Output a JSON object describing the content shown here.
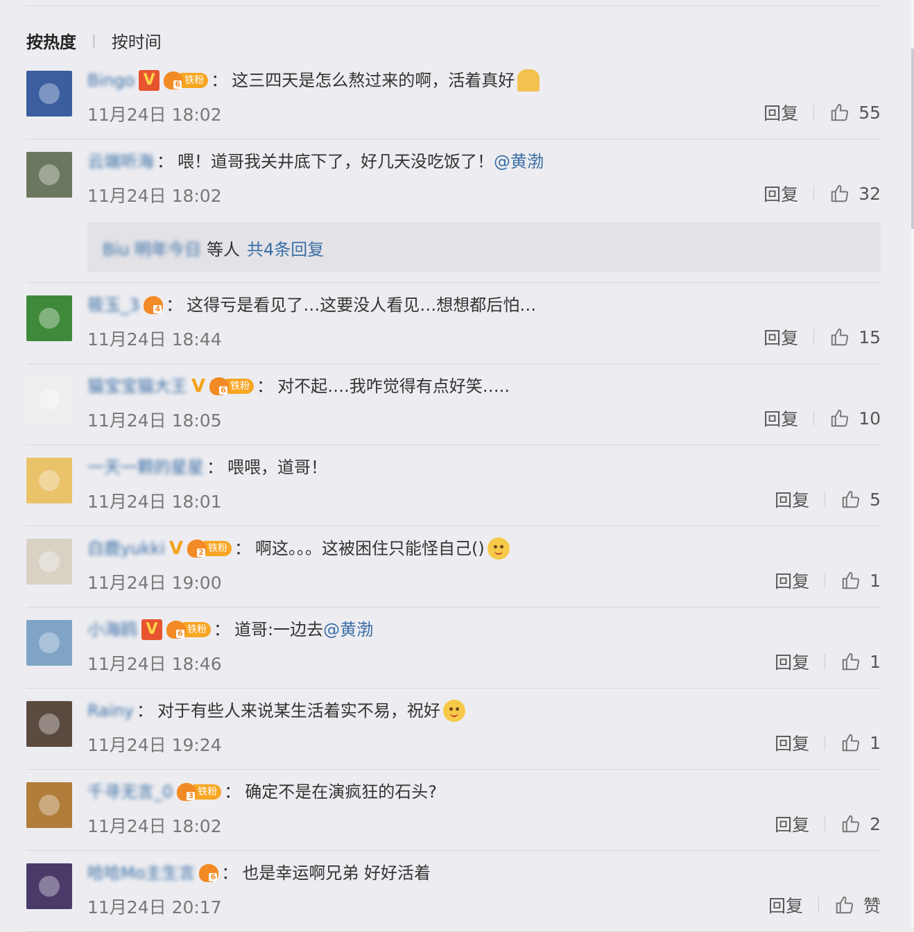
{
  "sort": {
    "active": "按热度",
    "other": "按时间"
  },
  "reply_label": "回复",
  "comments": [
    {
      "username": "Bingo",
      "badge_v": "red",
      "fan": {
        "level": "6",
        "label": "铁粉"
      },
      "text": "这三四天是怎么熬过来的啊，活着真好",
      "emoji": "pray-icon",
      "time": "11月24日 18:02",
      "likes": "55",
      "avatar_color": "#3a5ea0"
    },
    {
      "username": "云端听海",
      "badge_v": "",
      "fan": null,
      "text": "喂！道哥我关井底下了，好几天没吃饭了！",
      "mention": "@黄渤",
      "time": "11月24日 18:02",
      "likes": "32",
      "avatar_color": "#6b7760",
      "sub_replies": {
        "users": "Biu 明年今日",
        "etc": "等人",
        "link": "共4条回复"
      }
    },
    {
      "username": "筱玉_3",
      "badge_v": "",
      "fan": {
        "level": "4",
        "label": ""
      },
      "text": "这得亏是看见了…这要没人看见…想想都后怕…",
      "time": "11月24日 18:44",
      "likes": "15",
      "avatar_color": "#3f8a3a"
    },
    {
      "username": "猫宝宝猫大王",
      "badge_v": "gold",
      "fan": {
        "level": "6",
        "label": "铁粉"
      },
      "text": "对不起….我咋觉得有点好笑…..",
      "time": "11月24日 18:05",
      "likes": "10",
      "avatar_color": "#eeeeee"
    },
    {
      "username": "一天一颗的星星",
      "badge_v": "",
      "fan": null,
      "text": "喂喂，道哥！",
      "time": "11月24日 18:01",
      "likes": "5",
      "avatar_color": "#e9c26a"
    },
    {
      "username": "白鹿yukki",
      "badge_v": "gold",
      "fan": {
        "level": "2",
        "label": "铁粉"
      },
      "text": "啊这。。。这被困住只能怪自己()",
      "emoji": "doge-icon",
      "time": "11月24日 19:00",
      "likes": "1",
      "avatar_color": "#d9d2c4"
    },
    {
      "username": "小海鸥",
      "badge_v": "red",
      "fan": {
        "level": "6",
        "label": "铁粉"
      },
      "text": "道哥:一边去",
      "mention": "@黄渤",
      "time": "11月24日 18:46",
      "likes": "1",
      "avatar_color": "#7fa4c6"
    },
    {
      "username": "Rainy",
      "badge_v": "",
      "fan": null,
      "text": "对于有些人来说某生活着实不易，祝好",
      "emoji": "smile-icon",
      "time": "11月24日 19:24",
      "likes": "1",
      "avatar_color": "#5b4a40"
    },
    {
      "username": "千寻无言_0",
      "badge_v": "",
      "fan": {
        "level": "3",
        "label": "铁粉"
      },
      "text": "确定不是在演疯狂的石头?",
      "time": "11月24日 18:02",
      "likes": "2",
      "avatar_color": "#b07d3b"
    },
    {
      "username": "哈哈Mo主生言",
      "badge_v": "",
      "fan": {
        "level": "6",
        "label": ""
      },
      "text": "也是幸运啊兄弟 好好活着",
      "time": "11月24日 20:17",
      "likes": "赞",
      "avatar_color": "#4a3a6a"
    }
  ]
}
